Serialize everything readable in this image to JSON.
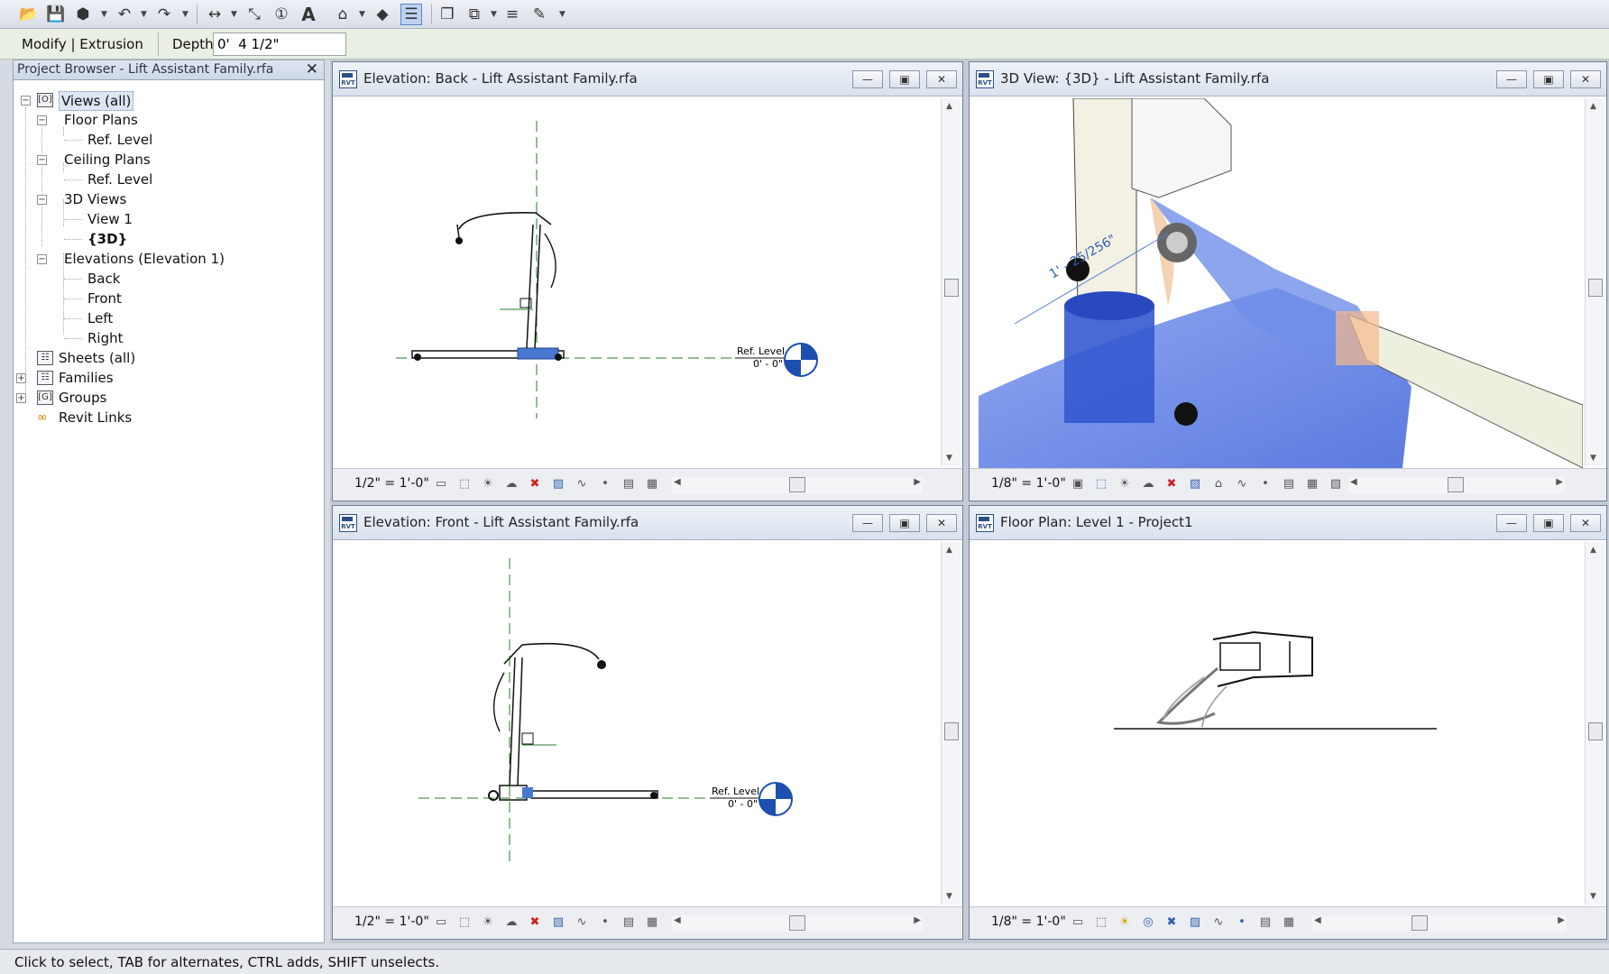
{
  "qat": {
    "icons": [
      "open-icon",
      "save-icon",
      "sync-icon",
      "undo-icon",
      "redo-icon",
      "measure-icon",
      "aligned-dimension-icon",
      "tag-icon",
      "text-icon",
      "3d-view-icon",
      "section-icon",
      "thin-lines-icon",
      "close-hidden-icon",
      "switch-windows-icon",
      "user-interface-icon",
      "customize-icon"
    ]
  },
  "optionsbar": {
    "mode": "Modify | Extrusion",
    "depth_label": "Depth",
    "depth_value": "0'  4 1/2\""
  },
  "project_browser": {
    "title": "Project Browser - Lift Assistant Family.rfa",
    "close": "✕",
    "nodes": {
      "views_all": "Views (all)",
      "floor_plans": "Floor Plans",
      "fp_ref_level": "Ref. Level",
      "ceiling_plans": "Ceiling Plans",
      "cp_ref_level": "Ref. Level",
      "views_3d": "3D Views",
      "view1": "View 1",
      "view3d": "{3D}",
      "elevations": "Elevations (Elevation 1)",
      "back": "Back",
      "front": "Front",
      "left": "Left",
      "right": "Right",
      "sheets": "Sheets (all)",
      "families": "Families",
      "groups": "Groups",
      "revit_links": "Revit Links"
    }
  },
  "windows": {
    "back": {
      "title": "Elevation: Back - Lift Assistant Family.rfa",
      "scale": "1/2\" = 1'-0\"",
      "level_name": "Ref. Level",
      "level_value": "0' - 0\""
    },
    "view3d": {
      "title": "3D View: {3D} - Lift Assistant Family.rfa",
      "scale": "1/8\" = 1'-0\"",
      "dimension": "1' - 25/256\""
    },
    "front": {
      "title": "Elevation: Front - Lift Assistant Family.rfa",
      "scale": "1/2\" = 1'-0\"",
      "level_name": "Ref. Level",
      "level_value": "0' - 0\""
    },
    "floorplan": {
      "title": "Floor Plan: Level 1 - Project1",
      "scale": "1/8\" = 1'-0\""
    }
  },
  "status": {
    "text": "Click to select, TAB for alternates, CTRL adds, SHIFT unselects."
  }
}
